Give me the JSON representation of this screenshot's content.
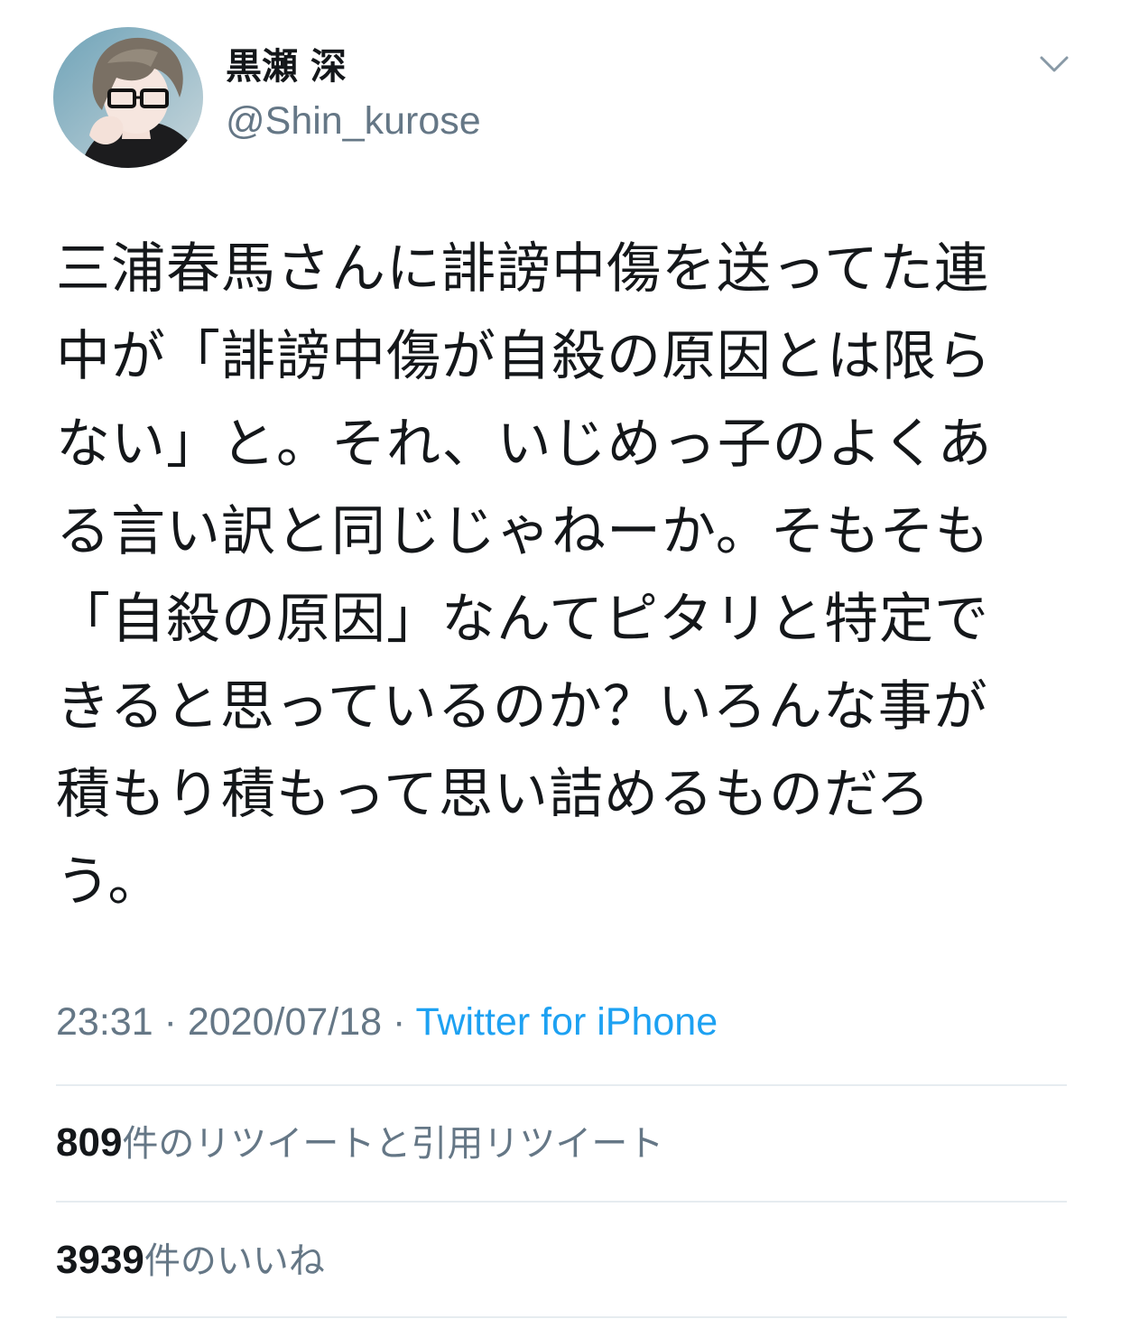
{
  "user": {
    "display_name": "黒瀬 深",
    "handle": "@Shin_kurose",
    "avatar_icon": "avatar-image"
  },
  "menu": {
    "icon": "chevron-down-icon"
  },
  "tweet": {
    "lines": [
      "三浦春馬さんに誹謗中傷を送ってた連",
      "中が「誹謗中傷が自殺の原因とは限ら",
      "ない」と。それ、いじめっ子のよくあ",
      "る言い訳と同じじゃねーか。そもそも",
      "「自殺の原因」なんてピタリと特定で",
      "きると思っているのか？いろんな事が",
      "積もり積もって思い詰めるものだろ",
      "う。"
    ]
  },
  "meta": {
    "time": "23:31",
    "separator": "·",
    "date": "2020/07/18",
    "source": "Twitter for iPhone"
  },
  "stats": {
    "retweets": {
      "count": "809",
      "label": "件のリツイートと引用リツイート"
    },
    "likes": {
      "count": "3939",
      "label": "件のいいね"
    }
  },
  "colors": {
    "text_primary": "#14171a",
    "text_secondary": "#657786",
    "link": "#1da1f2",
    "divider": "#e6ecf0"
  }
}
